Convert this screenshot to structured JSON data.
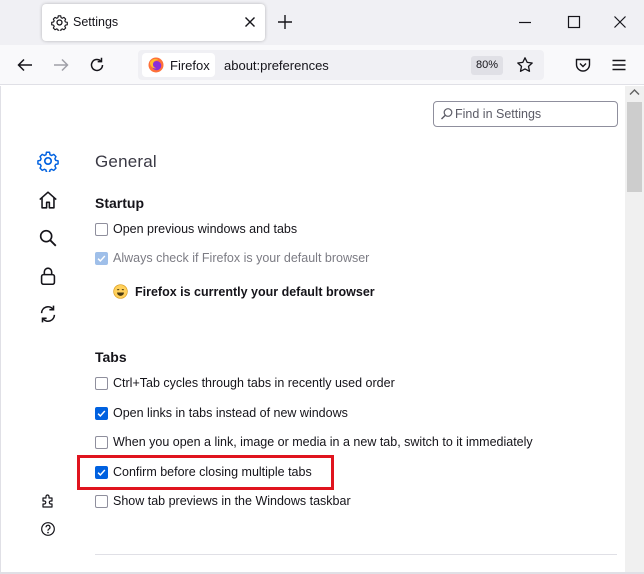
{
  "tab": {
    "title": "Settings"
  },
  "navbar": {
    "identity_label": "Firefox",
    "url": "about:preferences",
    "zoom": "80%"
  },
  "search": {
    "placeholder": "Find in Settings"
  },
  "sidebar": {
    "items": [
      {
        "icon": "gear-icon",
        "selected": true
      },
      {
        "icon": "home-icon"
      },
      {
        "icon": "search-icon"
      },
      {
        "icon": "lock-icon"
      },
      {
        "icon": "sync-icon"
      },
      {
        "icon": "extensions-icon"
      },
      {
        "icon": "help-icon"
      }
    ]
  },
  "page": {
    "title": "General",
    "startup": {
      "heading": "Startup",
      "open_previous": {
        "label": "Open previous windows and tabs",
        "checked": false
      },
      "always_check": {
        "label": "Always check if Firefox is your default browser",
        "checked": true,
        "disabled": true
      },
      "default_status": "Firefox is currently your default browser"
    },
    "tabs": {
      "heading": "Tabs",
      "options": [
        {
          "label": "Ctrl+Tab cycles through tabs in recently used order",
          "checked": false
        },
        {
          "label": "Open links in tabs instead of new windows",
          "checked": true
        },
        {
          "label": "When you open a link, image or media in a new tab, switch to it immediately",
          "checked": false
        },
        {
          "label": "Confirm before closing multiple tabs",
          "checked": true
        },
        {
          "label": "Show tab previews in the Windows taskbar",
          "checked": false
        }
      ]
    }
  },
  "colors": {
    "accent": "#0061e0",
    "highlight_border": "#e0141e",
    "chrome_bg": "#f0f0f4"
  }
}
